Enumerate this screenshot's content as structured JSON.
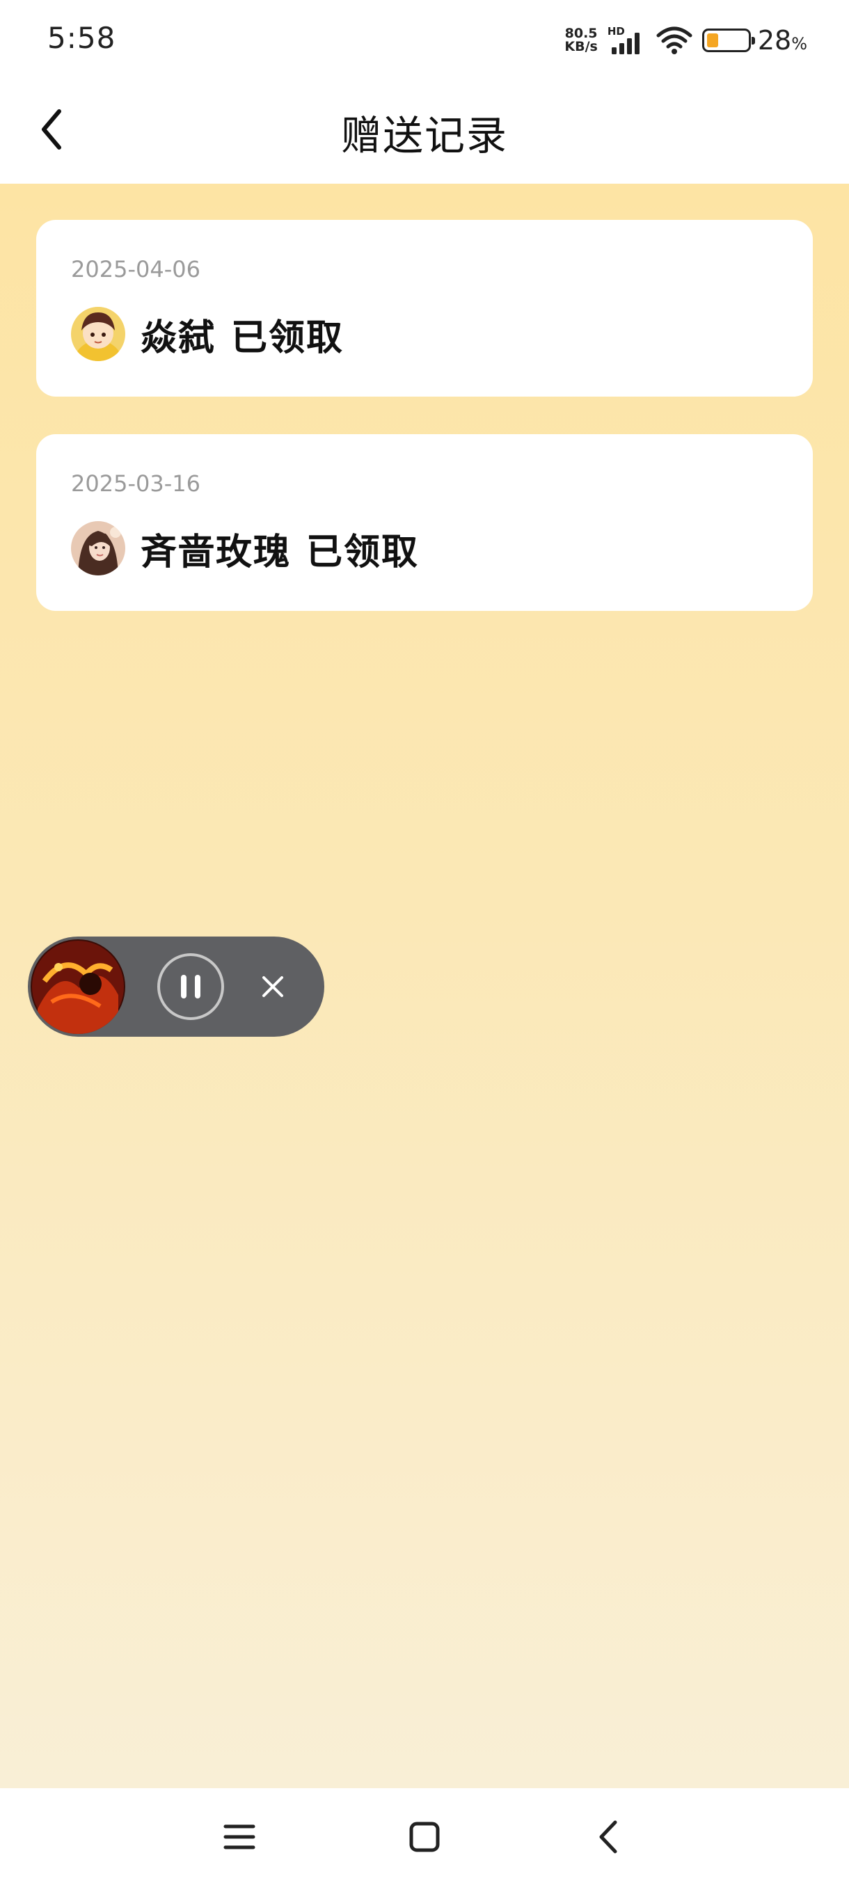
{
  "status_bar": {
    "time": "5:58",
    "net_speed_value": "80.5",
    "net_speed_unit": "KB/s",
    "hd_label": "HD",
    "battery_percent": "28",
    "battery_unit": "%",
    "battery_level": 0.28,
    "battery_color": "#f5a623"
  },
  "header": {
    "title": "赠送记录",
    "back_icon": "chevron-left-icon"
  },
  "records": [
    {
      "date": "2025-04-06",
      "name": "焱弑",
      "status": "已领取",
      "avatar": "cartoon-boy-yellow-hoodie"
    },
    {
      "date": "2025-03-16",
      "name": "斉啬玫瑰",
      "status": "已领取",
      "avatar": "woman-portrait"
    }
  ],
  "mini_player": {
    "cover": "album-art-fiery",
    "pause_icon": "pause-icon",
    "close_icon": "close-icon"
  },
  "nav_bar": {
    "menu_icon": "menu-icon",
    "home_icon": "home-icon",
    "back_icon": "back-icon"
  },
  "colors": {
    "background_top": "#fde4a4",
    "background_bottom": "#f9efd6",
    "card": "#ffffff",
    "player": "#5f6063"
  }
}
